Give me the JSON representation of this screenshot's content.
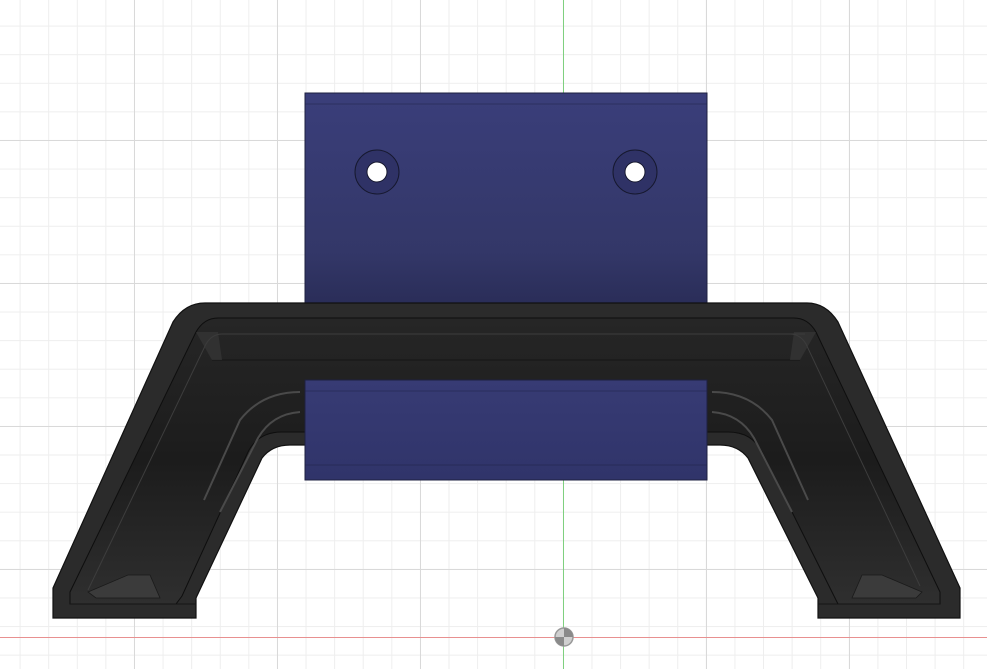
{
  "scene": {
    "view": "front",
    "background_color": "#ffffff",
    "grid_major_color": "#d9d9d9",
    "grid_minor_color": "#eeeeee",
    "axis_vertical_color": "#7fd07f",
    "axis_horizontal_color": "#e89090",
    "origin_marker_icon": "origin-point-icon"
  },
  "bodies": [
    {
      "name": "handle-frame",
      "color": "#2b2b2b",
      "material": "dark-gray"
    },
    {
      "name": "mounting-plate",
      "color": "#35386e",
      "material": "blue",
      "hole_count": 2
    }
  ]
}
